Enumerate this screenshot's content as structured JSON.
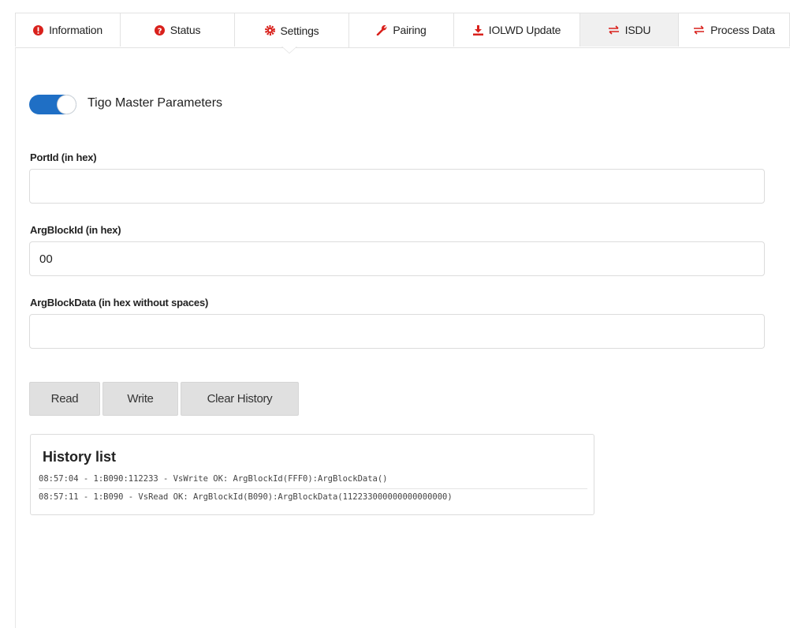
{
  "tabs": [
    {
      "id": "information",
      "label": "Information",
      "icon": "info-circle-icon"
    },
    {
      "id": "status",
      "label": "Status",
      "icon": "question-circle-icon"
    },
    {
      "id": "settings",
      "label": "Settings",
      "icon": "gear-icon",
      "active": true
    },
    {
      "id": "pairing",
      "label": "Pairing",
      "icon": "wrench-icon"
    },
    {
      "id": "iolwd-update",
      "label": "IOLWD Update",
      "icon": "download-icon"
    },
    {
      "id": "isdu",
      "label": "ISDU",
      "icon": "exchange-icon"
    },
    {
      "id": "process-data",
      "label": "Process Data",
      "icon": "exchange-icon"
    }
  ],
  "colors": {
    "accent": "#d9211c",
    "toggle": "#1f6fc5",
    "button_bg": "#e0e0e0"
  },
  "toggle": {
    "label": "Tigo Master Parameters",
    "on": true
  },
  "fields": {
    "port_id": {
      "label": "PortId (in hex)",
      "value": ""
    },
    "arg_block_id": {
      "label": "ArgBlockId (in hex)",
      "value": "00"
    },
    "arg_block_data": {
      "label": "ArgBlockData (in hex without spaces)",
      "value": ""
    }
  },
  "buttons": {
    "read": "Read",
    "write": "Write",
    "clear": "Clear History"
  },
  "history": {
    "title": "History list",
    "entries": [
      "08:57:04 - 1:B090:112233 - VsWrite OK: ArgBlockId(FFF0):ArgBlockData()",
      "08:57:11 - 1:B090 - VsRead OK: ArgBlockId(B090):ArgBlockData(112233000000000000000)"
    ]
  }
}
